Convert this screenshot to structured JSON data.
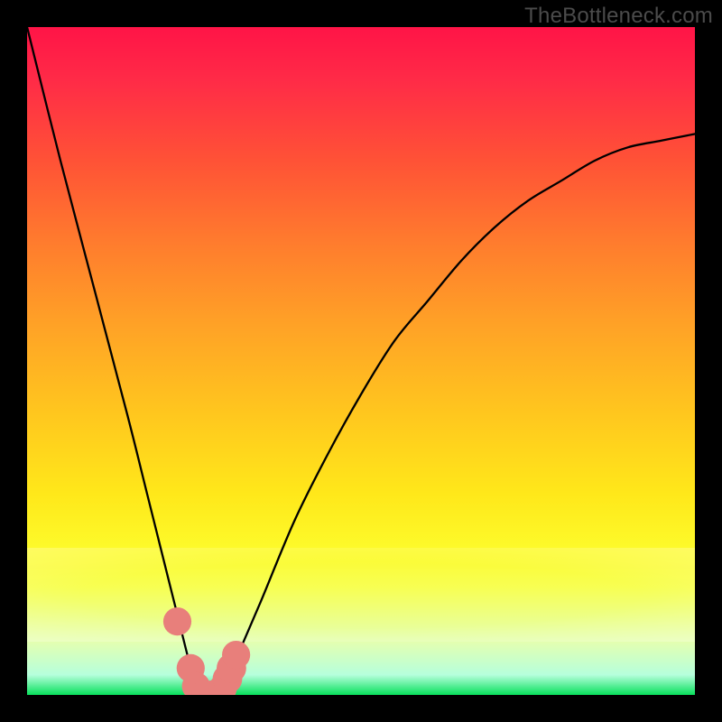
{
  "watermark": "TheBottleneck.com",
  "chart_data": {
    "type": "line",
    "title": "",
    "xlabel": "",
    "ylabel": "",
    "xlim": [
      0,
      100
    ],
    "ylim": [
      0,
      100
    ],
    "series": [
      {
        "name": "bottleneck-curve",
        "x": [
          0,
          5,
          10,
          15,
          18,
          20,
          22,
          24,
          25,
          26,
          27,
          28,
          29,
          30,
          32,
          35,
          40,
          45,
          50,
          55,
          60,
          65,
          70,
          75,
          80,
          85,
          90,
          95,
          100
        ],
        "values": [
          100,
          80,
          61,
          42,
          30,
          22,
          14,
          6,
          2,
          0,
          0,
          0,
          1,
          2,
          7,
          14,
          26,
          36,
          45,
          53,
          59,
          65,
          70,
          74,
          77,
          80,
          82,
          83,
          84
        ]
      }
    ],
    "markers": [
      {
        "x": 22.5,
        "y": 11,
        "r": 1.3
      },
      {
        "x": 24.5,
        "y": 4,
        "r": 1.3
      },
      {
        "x": 25.3,
        "y": 1.3,
        "r": 1.3
      },
      {
        "x": 26.5,
        "y": 0.3,
        "r": 1.1
      },
      {
        "x": 27.8,
        "y": 0.3,
        "r": 1.1
      },
      {
        "x": 29.3,
        "y": 1.0,
        "r": 1.3
      },
      {
        "x": 30.0,
        "y": 2.4,
        "r": 1.4
      },
      {
        "x": 30.6,
        "y": 4.0,
        "r": 1.4
      },
      {
        "x": 31.3,
        "y": 6.0,
        "r": 1.3
      }
    ],
    "gradient_stops": [
      {
        "pos": 0,
        "color": "#ff1447"
      },
      {
        "pos": 20,
        "color": "#ff5236"
      },
      {
        "pos": 45,
        "color": "#ffa326"
      },
      {
        "pos": 70,
        "color": "#ffe81a"
      },
      {
        "pos": 92,
        "color": "#e4ffb0"
      },
      {
        "pos": 100,
        "color": "#08e05c"
      }
    ]
  }
}
